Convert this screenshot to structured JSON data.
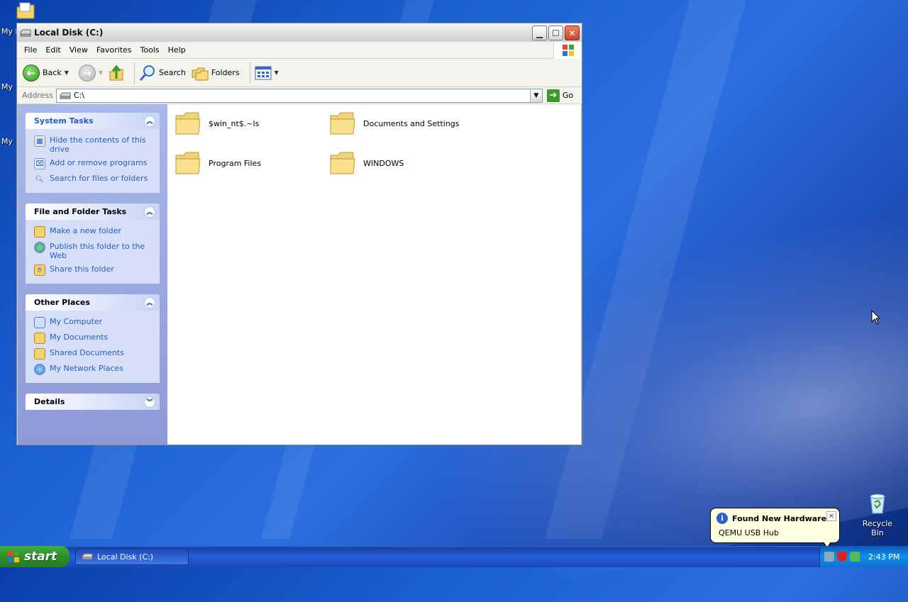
{
  "desktop": {
    "left_labels": [
      "My D",
      "My",
      "My"
    ],
    "recycle_bin_label": "Recycle Bin"
  },
  "window": {
    "title": "Local Disk (C:)",
    "menu": [
      "File",
      "Edit",
      "View",
      "Favorites",
      "Tools",
      "Help"
    ],
    "toolbar": {
      "back": "Back",
      "search": "Search",
      "folders": "Folders"
    },
    "address": {
      "label": "Address",
      "value": "C:\\",
      "go": "Go"
    },
    "taskpane": {
      "system_tasks": {
        "title": "System Tasks",
        "items": [
          "Hide the contents of this drive",
          "Add or remove programs",
          "Search for files or folders"
        ]
      },
      "file_folder_tasks": {
        "title": "File and Folder Tasks",
        "items": [
          "Make a new folder",
          "Publish this folder to the Web",
          "Share this folder"
        ]
      },
      "other_places": {
        "title": "Other Places",
        "items": [
          "My Computer",
          "My Documents",
          "Shared Documents",
          "My Network Places"
        ]
      },
      "details": {
        "title": "Details"
      }
    },
    "folders": [
      "$win_nt$.~ls",
      "Documents and Settings",
      "Program Files",
      "WINDOWS"
    ]
  },
  "taskbar": {
    "start": "start",
    "task_item": "Local Disk (C:)",
    "clock": "2:43 PM"
  },
  "balloon": {
    "title": "Found New Hardware",
    "message": "QEMU USB Hub"
  }
}
